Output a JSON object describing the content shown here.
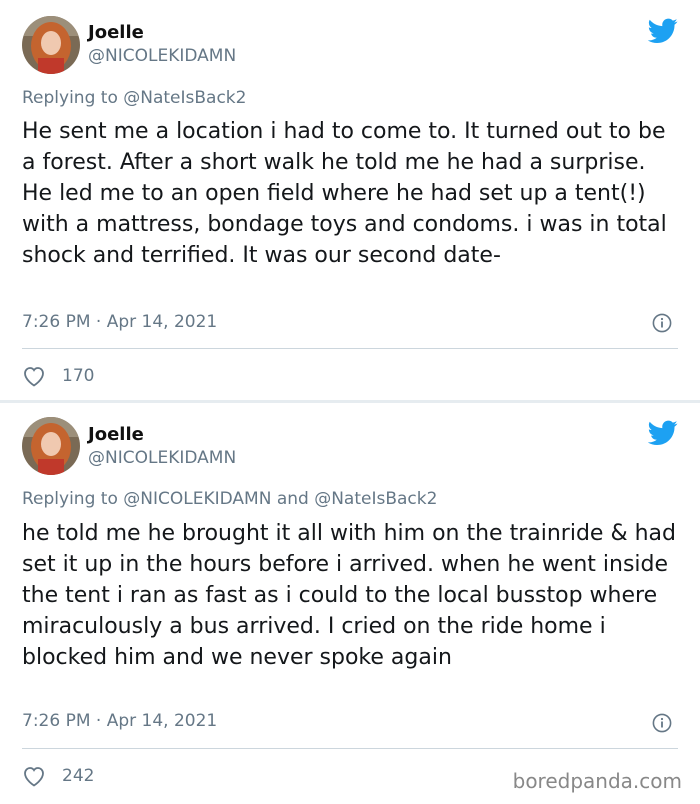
{
  "tweets": [
    {
      "name": "Joelle",
      "handle": "@NICOLEKIDAMN",
      "replying_prefix": "Replying to ",
      "replying_to": "@NateIsBack2",
      "text": "He sent me a location i had to come to. It turned out to be a forest. After a short walk he told me he had a surprise. He led me to an open field where he had set up a tent(!) with a mattress, bondage toys and condoms. i was in total shock and terrified. It was our second date-",
      "time": "7:26 PM · Apr 14, 2021",
      "likes": "170"
    },
    {
      "name": "Joelle",
      "handle": "@NICOLEKIDAMN",
      "replying_prefix": "Replying to ",
      "replying_to": "@NICOLEKIDAMN and @NateIsBack2",
      "text": "he told me he brought it all with him on the trainride & had set it up in the hours before i arrived. when he went inside the tent i ran as fast as i could to the local busstop where miraculously a bus arrived. I cried on the ride home i blocked him and we never spoke again",
      "time": "7:26 PM · Apr 14, 2021",
      "likes": "242"
    }
  ],
  "watermark": "boredpanda.com",
  "colors": {
    "twitter_blue": "#1da1f2",
    "muted": "#657786",
    "text": "#14171a",
    "divider": "#e6ecf0"
  },
  "icons": {
    "brand": "twitter-bird-icon",
    "info": "info-icon",
    "like": "heart-icon"
  }
}
